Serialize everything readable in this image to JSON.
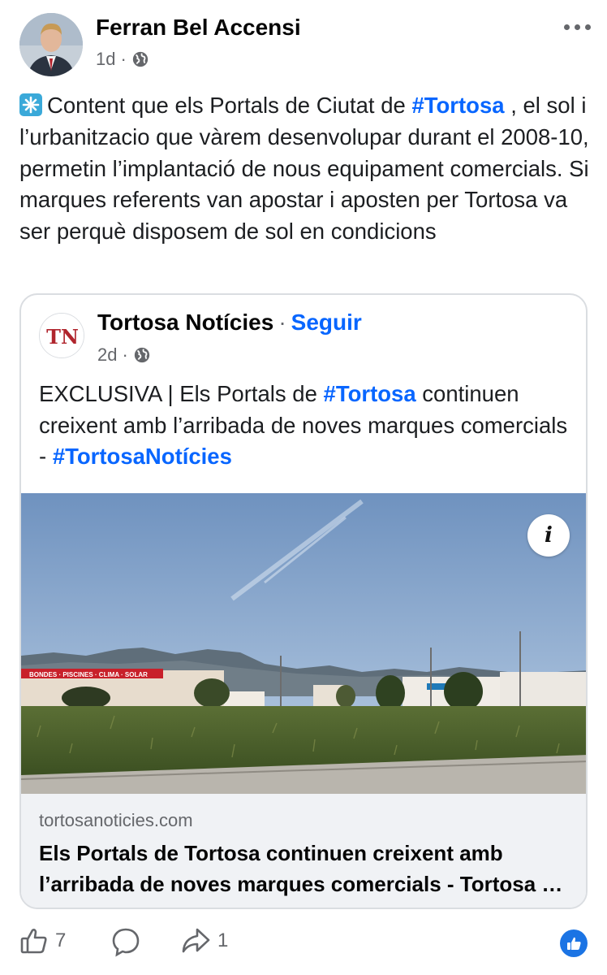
{
  "post": {
    "author": "Ferran Bel Accensi",
    "time": "1d",
    "separator": "·",
    "text_before": "Content que els Portals de Ciutat de ",
    "hashtag": "#Tortosa",
    "text_after": " , el sol i l’urbanitzacio que vàrem desenvolupar durant el 2008-10, permetin l’implantació de nous equipament comercials. Si marques referents van apostar i aposten  per Tortosa va ser perquè disposem de sol en condicions"
  },
  "shared": {
    "logo_text": "TN",
    "page_name": "Tortosa Notícies",
    "separator": "·",
    "follow_label": "Seguir",
    "time": "2d",
    "text_before": "EXCLUSIVA | Els Portals de ",
    "hashtag1": "#Tortosa",
    "text_middle": " continuen creixent amb l’arribada de noves marques comercials - ",
    "hashtag2": "#TortosaNotícies",
    "info_label": "i",
    "building_sign": "BONDES · PISCINES · CLIMA · SOLAR",
    "link_domain": "tortosanoticies.com",
    "link_title_line1": "Els Portals de Tortosa continuen creixent amb",
    "link_title_line2": "l’arribada de noves marques comercials - Tortosa Notícies"
  },
  "actions": {
    "like_count": "7",
    "share_count": "1"
  },
  "colors": {
    "link_blue": "#0866ff",
    "secondary_text": "#65676b",
    "reaction_blue": "#1b74e4"
  }
}
